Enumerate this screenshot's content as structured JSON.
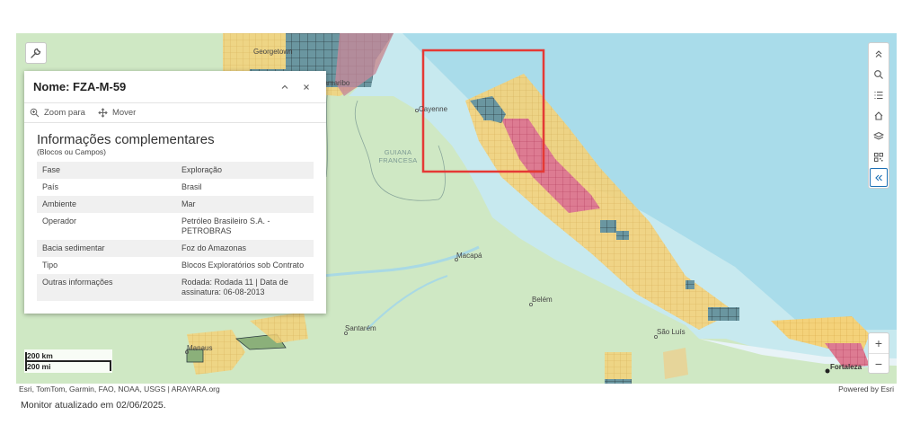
{
  "popup": {
    "title": "Nome: FZA-M-59",
    "actions": {
      "zoom_label": "Zoom para",
      "move_label": "Mover"
    },
    "section_title": "Informações complementares",
    "section_subtitle": "(Blocos ou Campos)",
    "rows": [
      {
        "key": "Fase",
        "value": "Exploração"
      },
      {
        "key": "País",
        "value": "Brasil"
      },
      {
        "key": "Ambiente",
        "value": "Mar"
      },
      {
        "key": "Operador",
        "value": "Petróleo Brasileiro S.A. - PETROBRAS"
      },
      {
        "key": "Bacia sedimentar",
        "value": "Foz do Amazonas"
      },
      {
        "key": "Tipo",
        "value": "Blocos Exploratórios sob Contrato"
      },
      {
        "key": "Outras informações",
        "value": "Rodada: Rodada 11 | Data de assinatura: 06-08-2013"
      }
    ]
  },
  "map_labels": {
    "georgetown": "Georgetown",
    "paramaribo": "Paramaribo",
    "cayenne": "Cayenne",
    "guiana_francesa": "GUIANA FRANCESA",
    "macapa": "Macapá",
    "belem": "Belém",
    "santarem": "Santarém",
    "manaus": "Manaus",
    "sao_luis": "São Luís",
    "fortaleza": "Fortaleza"
  },
  "scalebar": {
    "km_label": "200 km",
    "mi_label": "200 mi"
  },
  "zoom": {
    "in_label": "+",
    "out_label": "−"
  },
  "attribution": {
    "left": "Esri, TomTom, Garmin, FAO, NOAA, USGS | ARAYARA.org",
    "right": "Powered by Esri"
  },
  "footer_note": "Monitor atualizado em 02/06/2025.",
  "colors": {
    "land": "#cfe8c4",
    "ocean": "#c7e9ef",
    "deep_water": "#9fd6e6",
    "block_yellow": "#f2cf6e",
    "block_red": "#d86d88",
    "block_dark": "#5b8793",
    "highlight": "#e53935",
    "active_button": "#1a6fb5"
  },
  "icons": {
    "tool": "wrench-icon",
    "zoom_to": "zoom-in-icon",
    "move": "move-icon",
    "collapse": "chevron-up-icon",
    "close": "close-icon",
    "toolbar": [
      "double-chevron-up-icon",
      "search-icon",
      "list-icon",
      "home-icon",
      "layers-icon",
      "qr-grid-icon",
      "double-chevron-left-icon"
    ]
  }
}
